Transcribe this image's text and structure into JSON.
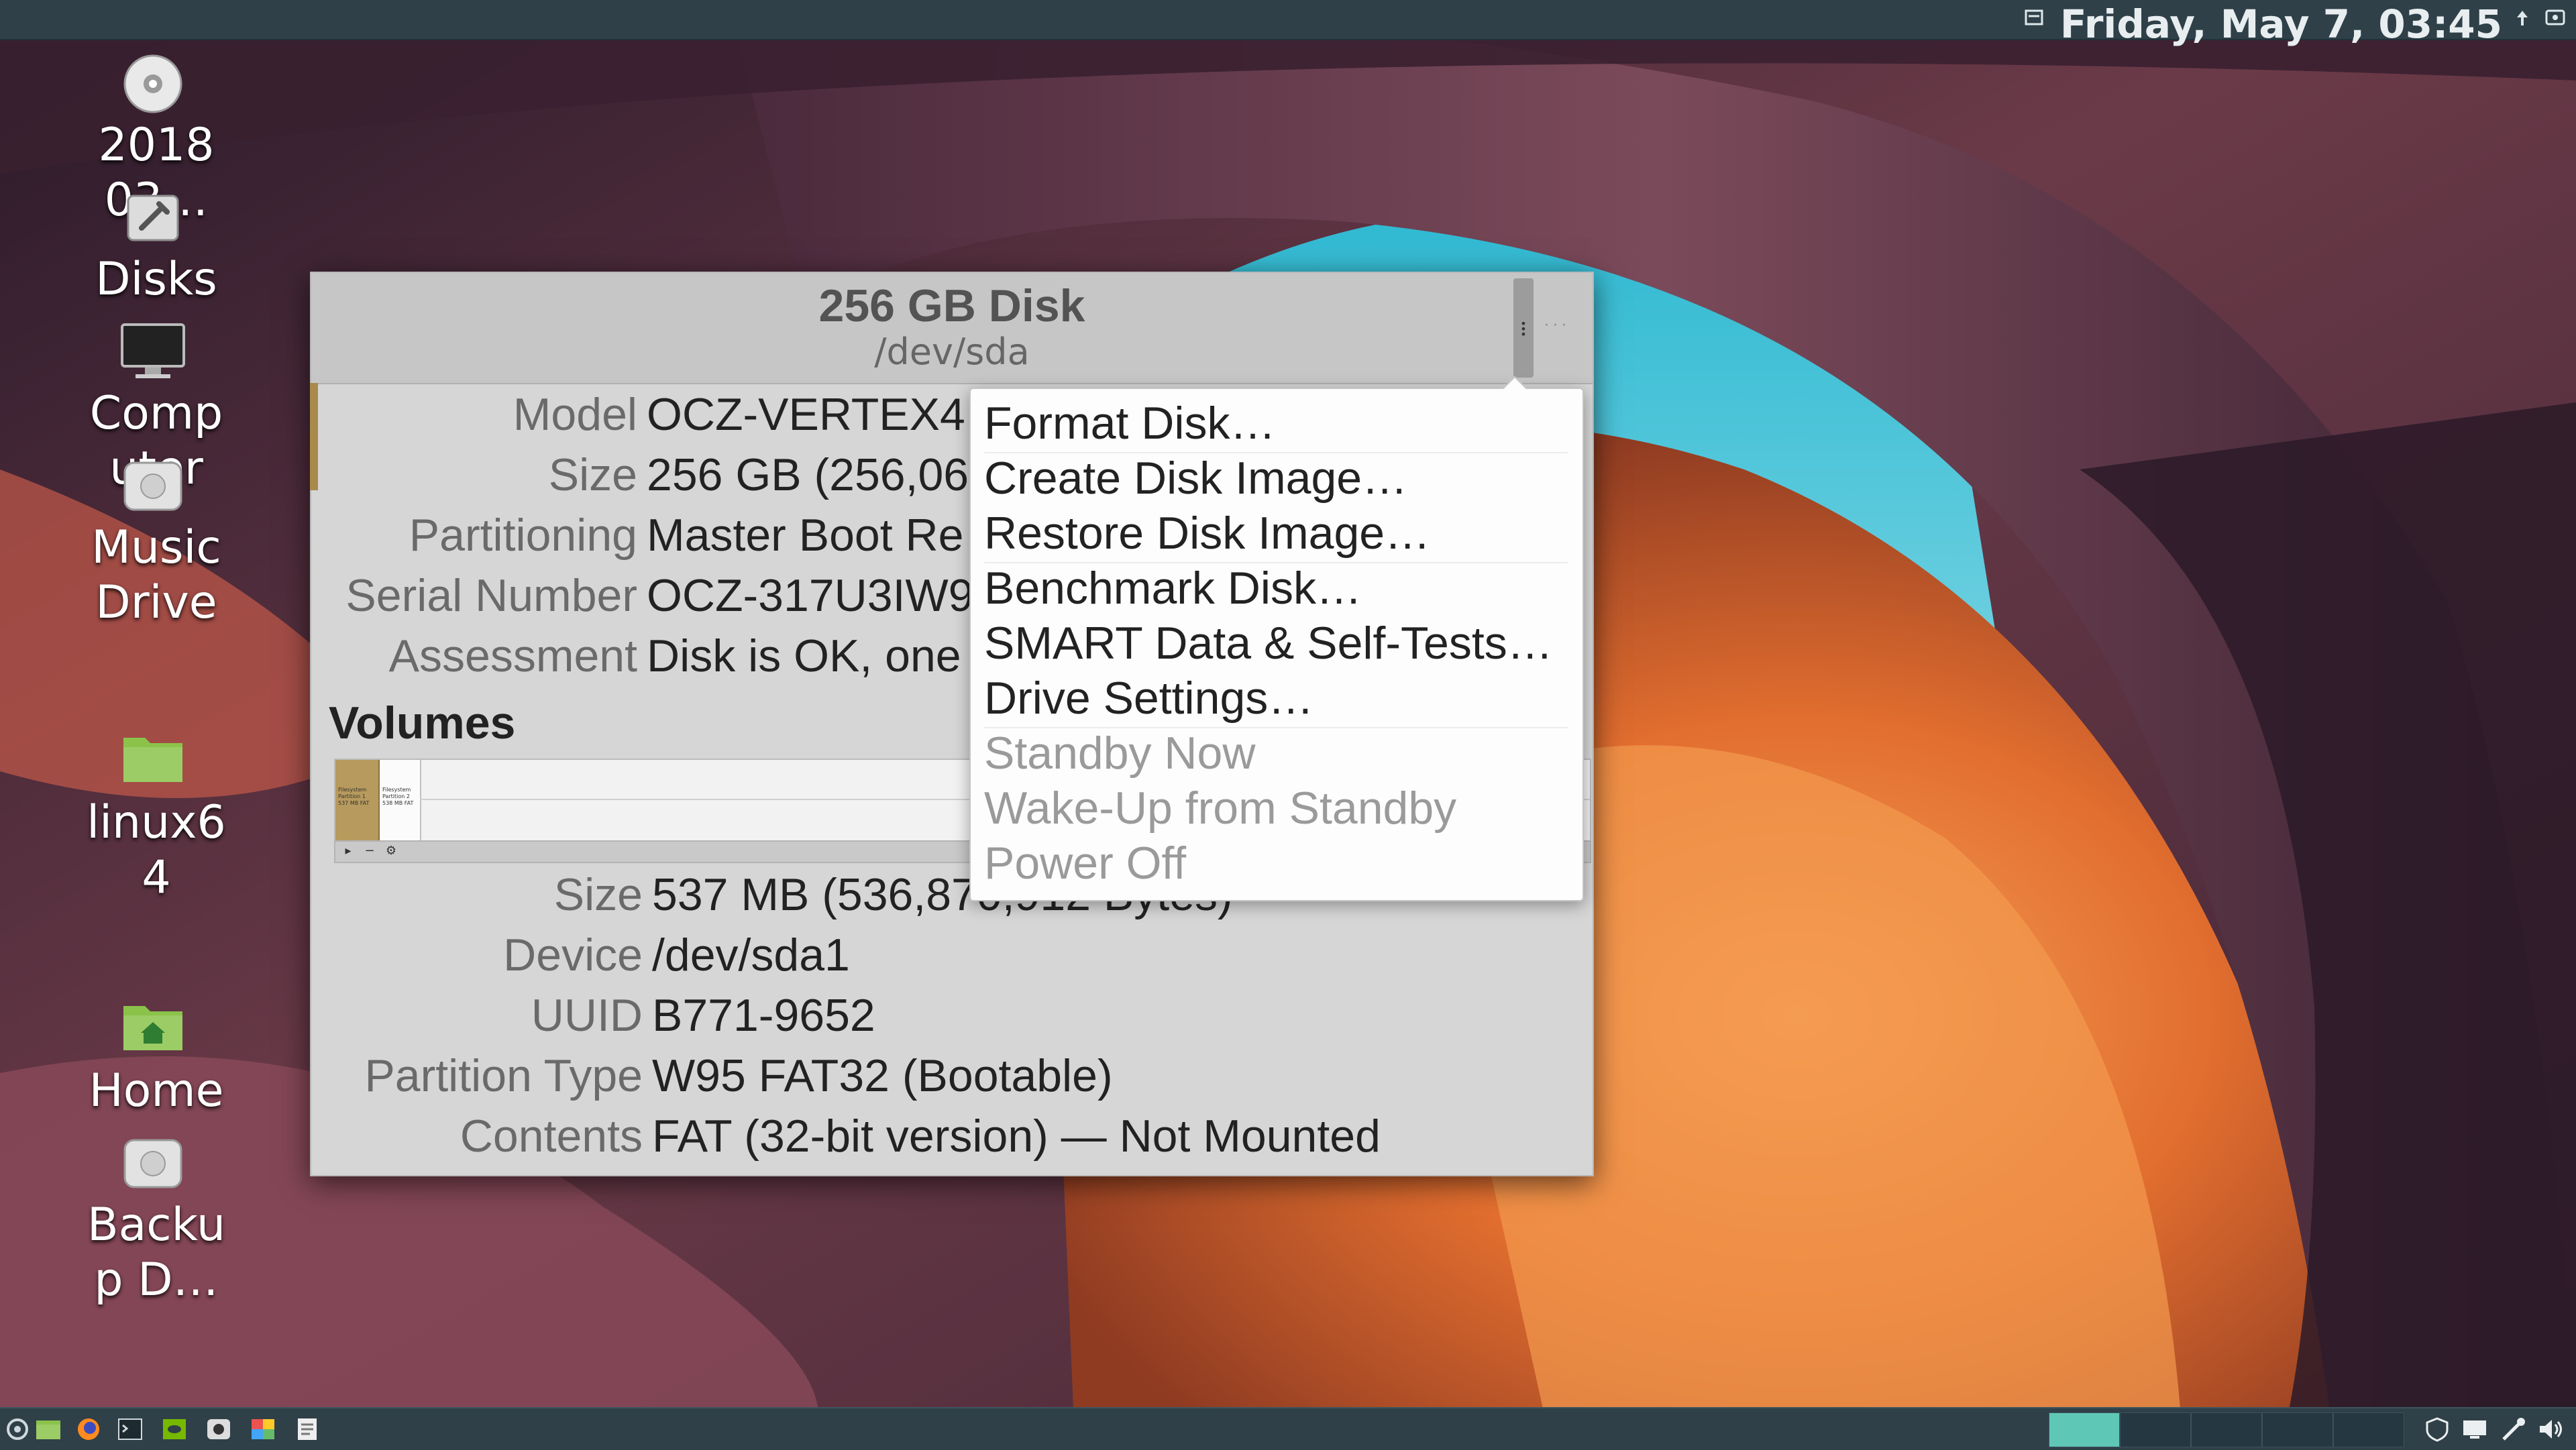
{
  "top_panel": {
    "clock": "Friday, May  7, 03:45"
  },
  "desktop": {
    "icons": [
      {
        "label": "2018\n03…",
        "icon": "optical-disc-icon"
      },
      {
        "label": "Disks",
        "icon": "disks-utility-icon"
      },
      {
        "label": "Comp\nuter",
        "icon": "computer-monitor-icon"
      },
      {
        "label": "Music\nDrive",
        "icon": "hard-drive-icon"
      },
      {
        "label": "linux6\n4",
        "icon": "folder-icon"
      },
      {
        "label": "Home",
        "icon": "home-folder-icon"
      },
      {
        "label": "Backu\np D…",
        "icon": "hard-drive-icon"
      }
    ]
  },
  "window": {
    "title": "256 GB Disk",
    "subtitle": "/dev/sda",
    "disk_properties": [
      {
        "label": "Model",
        "value": "OCZ-VERTEX4"
      },
      {
        "label": "Size",
        "value": "256 GB (256,06"
      },
      {
        "label": "Partitioning",
        "value": "Master Boot Re"
      },
      {
        "label": "Serial Number",
        "value": "OCZ-317U3IW9"
      },
      {
        "label": "Assessment",
        "value": "Disk is OK, one"
      }
    ],
    "volumes_heading": "Volumes",
    "volume_map": {
      "partition1_text": "Filesystem\nPartition 1\n537 MB FAT",
      "partition2_text": "Filesystem\nPartition 2\n538 MB FAT"
    },
    "volume_properties": [
      {
        "label": "Size",
        "value": "537 MB (536,870,912 Bytes)"
      },
      {
        "label": "Device",
        "value": "/dev/sda1"
      },
      {
        "label": "UUID",
        "value": "B771-9652"
      },
      {
        "label": "Partition Type",
        "value": "W95 FAT32 (Bootable)"
      },
      {
        "label": "Contents",
        "value": "FAT (32-bit version) — Not Mounted"
      }
    ]
  },
  "menu": {
    "items": [
      {
        "label": "Format Disk…",
        "enabled": true
      },
      {
        "label": "Create Disk Image…",
        "enabled": true
      },
      {
        "label": "Restore Disk Image…",
        "enabled": true
      },
      {
        "label": "Benchmark Disk…",
        "enabled": true
      },
      {
        "label": "SMART Data & Self-Tests…",
        "enabled": true
      },
      {
        "label": "Drive Settings…",
        "enabled": true
      },
      {
        "label": "Standby Now",
        "enabled": false
      },
      {
        "label": "Wake-Up from Standby",
        "enabled": false
      },
      {
        "label": "Power Off",
        "enabled": false
      }
    ]
  },
  "bottom_panel": {
    "launchers": [
      "menu-icon",
      "files-icon",
      "firefox-icon",
      "terminal-icon",
      "nvidia-icon",
      "disk-icon",
      "color-picker-icon",
      "text-editor-icon"
    ],
    "active_workspace": 1,
    "tray": [
      "shield-icon",
      "display-icon",
      "network-icon",
      "volume-icon"
    ]
  },
  "colors": {
    "panel": "#2f4048",
    "workspace_active": "#5fc7b5",
    "window_bg": "#d6d6d6",
    "partition_selected": "#b79a5d"
  }
}
